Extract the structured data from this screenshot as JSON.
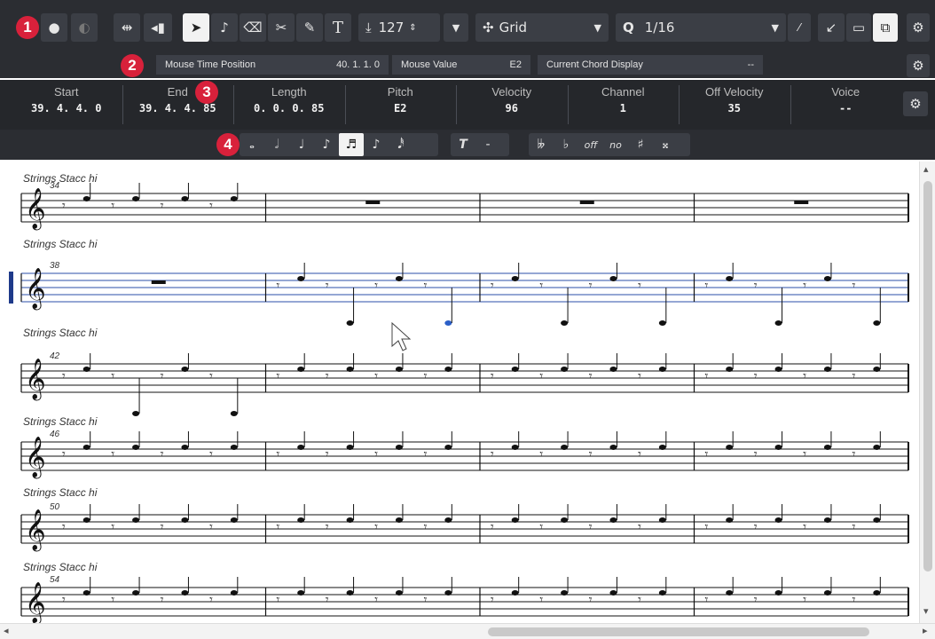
{
  "toolbar": {
    "velocity": "127",
    "snap_mode": "Grid",
    "quantize": "1/16",
    "quantize_icon": "Q",
    "callout_1": "1"
  },
  "info_line": {
    "callout_2": "2",
    "mouse_time_label": "Mouse Time Position",
    "mouse_time_value": "40. 1. 1.   0",
    "mouse_value_label": "Mouse Value",
    "mouse_value_value": "E2",
    "chord_label": "Current Chord Display",
    "chord_value": "--"
  },
  "note_info": {
    "callout_3": "3",
    "columns": [
      {
        "label": "Start",
        "value": "39. 4. 4.   0"
      },
      {
        "label": "End",
        "value": "39. 4. 4. 85"
      },
      {
        "label": "Length",
        "value": "0. 0. 0. 85"
      },
      {
        "label": "Pitch",
        "value": "E2"
      },
      {
        "label": "Velocity",
        "value": "96"
      },
      {
        "label": "Channel",
        "value": "1"
      },
      {
        "label": "Off Velocity",
        "value": "35"
      },
      {
        "label": "Voice",
        "value": "--"
      }
    ]
  },
  "symbols": {
    "callout_4": "4",
    "text_tool": "T",
    "text_tool_dash": "-",
    "enh_off": "off",
    "enh_no": "no"
  },
  "score": {
    "systems": [
      {
        "name": "Strings Stacc hi",
        "bar": "34"
      },
      {
        "name": "Strings Stacc hi",
        "bar": "38"
      },
      {
        "name": "Strings Stacc hi",
        "bar": "42"
      },
      {
        "name": "Strings Stacc hi",
        "bar": "46"
      },
      {
        "name": "Strings Stacc hi",
        "bar": "50"
      },
      {
        "name": "Strings Stacc hi",
        "bar": "54"
      }
    ]
  },
  "icons": [
    "record-icon",
    "pointer-icon",
    "note-icon",
    "eraser-icon",
    "scissors-icon",
    "glue-icon",
    "text-icon",
    "settings-icon"
  ],
  "colors": {
    "toolbar_bg": "#2b2d32",
    "accent": "#d8213b",
    "selection": "#1e3a8a"
  }
}
